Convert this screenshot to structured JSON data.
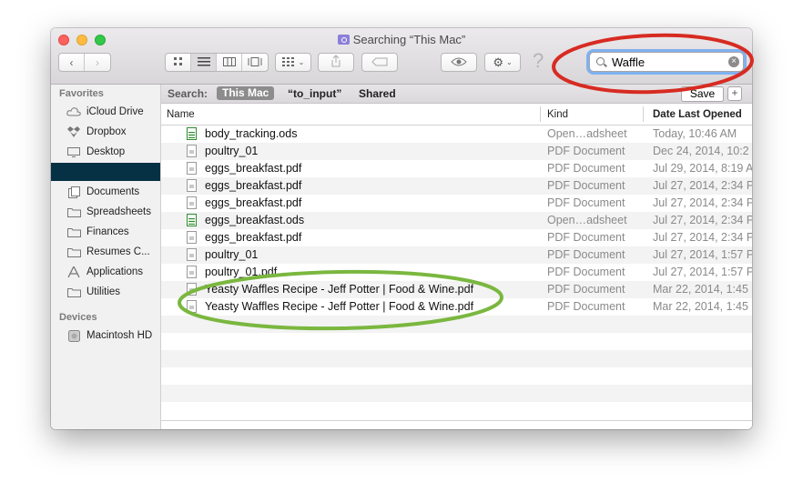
{
  "window": {
    "title": "Searching “This Mac”"
  },
  "toolbar": {
    "back_icon": "chevron-left-icon",
    "forward_icon": "chevron-right-icon",
    "help_glyph": "?",
    "search_value": "Waffle"
  },
  "sidebar": {
    "favorites_header": "Favorites",
    "devices_header": "Devices",
    "favorites": [
      {
        "label": "iCloud Drive",
        "icon": "cloud-icon"
      },
      {
        "label": "Dropbox",
        "icon": "dropbox-icon"
      },
      {
        "label": "Desktop",
        "icon": "desktop-icon"
      },
      {
        "label": "",
        "icon": ""
      },
      {
        "label": "Documents",
        "icon": "documents-icon"
      },
      {
        "label": "Spreadsheets",
        "icon": "folder-icon"
      },
      {
        "label": "Finances",
        "icon": "folder-icon"
      },
      {
        "label": "Resumes C...",
        "icon": "folder-icon"
      },
      {
        "label": "Applications",
        "icon": "applications-icon"
      },
      {
        "label": "Utilities",
        "icon": "folder-icon"
      }
    ],
    "devices": [
      {
        "label": "Macintosh HD",
        "icon": "harddrive-icon"
      }
    ]
  },
  "scopebar": {
    "label": "Search:",
    "this_mac": "This Mac",
    "to_input": "“to_input”",
    "shared": "Shared",
    "save": "Save",
    "plus": "+"
  },
  "columns": {
    "name": "Name",
    "kind": "Kind",
    "date": "Date Last Opened"
  },
  "files": [
    {
      "name": "body_tracking.ods",
      "kind": "Open…adsheet",
      "date": "Today, 10:46 AM",
      "type": "ods"
    },
    {
      "name": "poultry_01",
      "kind": "PDF Document",
      "date": "Dec 24, 2014, 10:2",
      "type": "pdf"
    },
    {
      "name": "eggs_breakfast.pdf",
      "kind": "PDF Document",
      "date": "Jul 29, 2014, 8:19 A",
      "type": "pdf"
    },
    {
      "name": "eggs_breakfast.pdf",
      "kind": "PDF Document",
      "date": "Jul 27, 2014, 2:34 P",
      "type": "pdf"
    },
    {
      "name": "eggs_breakfast.pdf",
      "kind": "PDF Document",
      "date": "Jul 27, 2014, 2:34 P",
      "type": "pdf"
    },
    {
      "name": "eggs_breakfast.ods",
      "kind": "Open…adsheet",
      "date": "Jul 27, 2014, 2:34 P",
      "type": "ods"
    },
    {
      "name": "eggs_breakfast.pdf",
      "kind": "PDF Document",
      "date": "Jul 27, 2014, 2:34 P",
      "type": "pdf"
    },
    {
      "name": "poultry_01",
      "kind": "PDF Document",
      "date": "Jul 27, 2014, 1:57 P",
      "type": "pdf"
    },
    {
      "name": "poultry_01.pdf",
      "kind": "PDF Document",
      "date": "Jul 27, 2014, 1:57 P",
      "type": "pdf"
    },
    {
      "name": "Yeasty Waffles Recipe - Jeff Potter | Food & Wine.pdf",
      "kind": "PDF Document",
      "date": "Mar 22, 2014, 1:45",
      "type": "pdf"
    },
    {
      "name": "Yeasty Waffles Recipe - Jeff Potter | Food & Wine.pdf",
      "kind": "PDF Document",
      "date": "Mar 22, 2014, 1:45",
      "type": "pdf"
    }
  ],
  "colors": {
    "sidebar_selection": "#063145",
    "red_annotation": "#d72b22",
    "green_annotation": "#7ab73f",
    "search_focus": "#7fb1f0"
  }
}
